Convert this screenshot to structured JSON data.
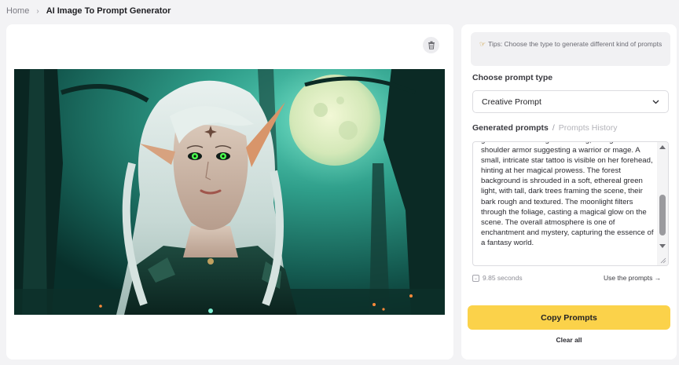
{
  "breadcrumb": {
    "home": "Home",
    "separator": "›",
    "current": "AI Image To Prompt Generator"
  },
  "image_panel": {
    "delete_icon": "trash-icon",
    "image_alt": "AI generated fantasy elf with silver hair and glowing green eyes in a moonlit forest"
  },
  "tips": {
    "icon": "pointing-hand-icon",
    "text": "Tips: Choose the type to generate different kind of prompts"
  },
  "prompt_type": {
    "label": "Choose prompt type",
    "selected": "Creative Prompt",
    "chevron_icon": "chevron-down-icon"
  },
  "generated": {
    "active_tab": "Generated prompts",
    "separator": "/",
    "history_tab": "Prompts History",
    "text": "gown with intricate gold detailing, its high collar and shoulder armor suggesting a warrior or mage. A small, intricate star tattoo is visible on her forehead, hinting at her magical prowess. The forest background is shrouded in a soft, ethereal green light, with tall, dark trees framing the scene, their bark rough and textured. The moonlight filters through the foliage, casting a magical glow on the scene. The overall atmosphere is one of enchantment and mystery, capturing the essence of a fantasy world."
  },
  "footer": {
    "timing": "9.85 seconds",
    "use_prompts": "Use the prompts →",
    "copy_button": "Copy Prompts",
    "clear_all": "Clear all"
  },
  "colors": {
    "accent": "#fbd24a",
    "background": "#f3f3f5",
    "panel": "#ffffff"
  }
}
